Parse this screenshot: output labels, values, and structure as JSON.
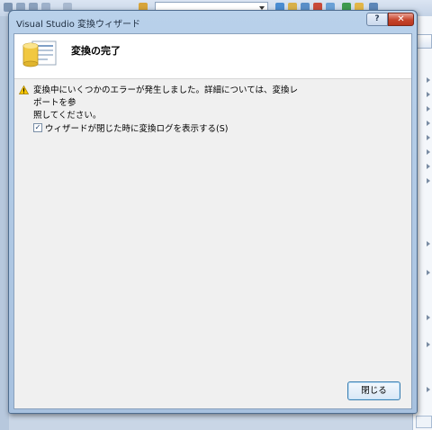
{
  "dialog": {
    "title": "Visual Studio 変換ウィザード",
    "help_label": "?",
    "close_label": "✕"
  },
  "header": {
    "title": "変換の完了"
  },
  "warning": {
    "text_line1": "変換中にいくつかのエラーが発生しました。詳細については、変換レポートを参",
    "text_line2": "照してください。"
  },
  "option": {
    "checked": true,
    "check_glyph": "✓",
    "label": "ウィザードが閉じた時に変換ログを表示する(S)"
  },
  "footer": {
    "close_button_label": "閉じる"
  },
  "colors": {
    "title_bar": "#b9d1ea",
    "close_button_red": "#c6452b",
    "client_bg": "#f0f0f0",
    "header_bg": "#ffffff",
    "warning_yellow": "#f5c400"
  }
}
